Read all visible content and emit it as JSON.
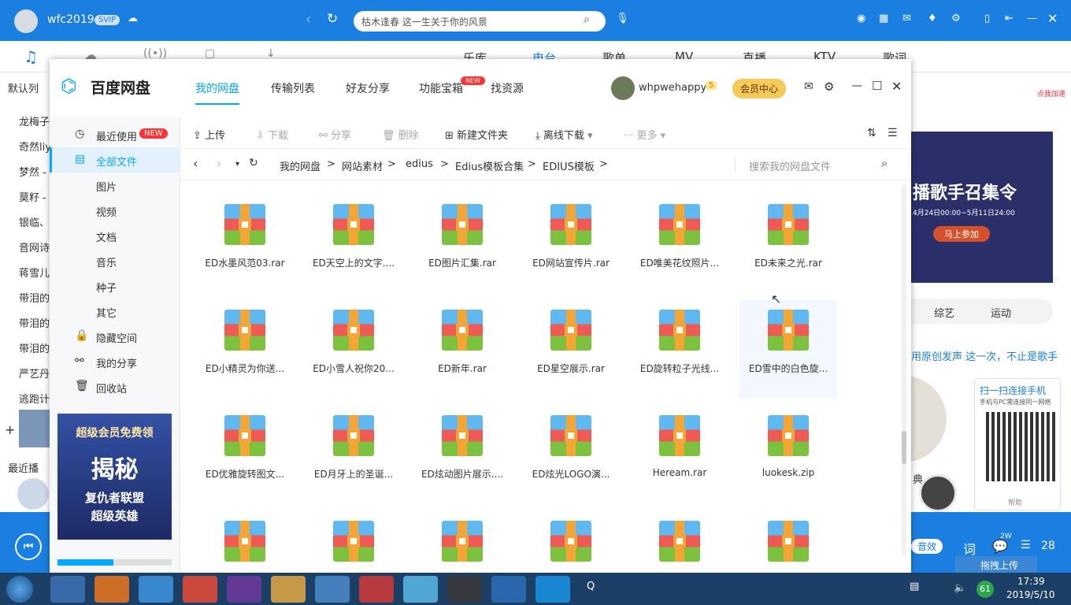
{
  "music_app": {
    "username": "wfc2019",
    "svip": "SVIP",
    "search_placeholder": "枯木逢春 这一生关于你的风景",
    "tabs": [
      "乐库",
      "电台",
      "歌单",
      "MV",
      "直播",
      "KTV",
      "歌词"
    ],
    "left_section": "默认列",
    "playlist": [
      "龙梅子",
      "奇然liy",
      "梦然 -",
      "莫籽 -",
      "银临、",
      "音网诗",
      "蒋雪儿",
      "带泪的",
      "带泪的",
      "带泪的",
      "严艺丹",
      "逃跑计"
    ],
    "recent_label": "最近播",
    "right_tabs": [
      "综艺",
      "运动"
    ],
    "right_caption": "用原创发声 这一次，不止是歌手",
    "promo_banner": "播歌手召集令",
    "promo_date": "4月24日00:00~5月11日24:00",
    "promo_button": "马上参加",
    "qr_title": "扫一扫连接手机",
    "qr_sub": "手机与PC需连接同一网络",
    "qr_help": "帮助",
    "bottom_sound": "音效",
    "bottom_lyric": "词",
    "bottom_comment_count": "2W",
    "bottom_list_count": "28",
    "upload_drag": "拖拽上传",
    "partial_dian": "典",
    "partial_label": "点我加速"
  },
  "pan": {
    "logo_text": "百度网盘",
    "nav": [
      "我的网盘",
      "传输列表",
      "好友分享",
      "功能宝箱",
      "找资源"
    ],
    "nav_new_badge": "NEW",
    "user": "whpwehappy",
    "vip_level": "5",
    "vip_center": "会员中心",
    "sidebar": {
      "recent": "最近使用",
      "recent_badge": "NEW",
      "all_files": "全部文件",
      "categories": [
        "图片",
        "视频",
        "文档",
        "音乐",
        "种子",
        "其它"
      ],
      "hidden_space": "隐藏空间",
      "my_share": "我的分享",
      "recycle": "回收站",
      "ad_line1": "超级会员免费领",
      "ad_line2": "揭秘",
      "ad_line3": "复仇者联盟",
      "ad_line4": "超级英雄"
    },
    "toolbar": {
      "upload": "上传",
      "download": "下载",
      "share": "分享",
      "delete": "删除",
      "new_folder": "新建文件夹",
      "offline": "离线下载",
      "more": "更多"
    },
    "path": [
      "我的网盘",
      "网站素材",
      "edius",
      "Edius模板合集",
      "EDIUS模板"
    ],
    "search_placeholder": "搜索我的网盘文件",
    "files": [
      "ED水墨风范03.rar",
      "ED天空上的文字....",
      "ED图片汇集.rar",
      "ED网站宣传片.rar",
      "ED唯美花纹照片...",
      "ED未来之光.rar",
      "ED小精灵为你送...",
      "ED小雪人祝你20...",
      "ED新年.rar",
      "ED星空展示.rar",
      "ED旋转粒子光线...",
      "ED雪中的白色旋...",
      "ED优雅旋转图文...",
      "ED月牙上的圣诞...",
      "ED炫动图片展示....",
      "ED炫光LOGO演...",
      "Heream.rar",
      "luokesk.zip",
      "",
      "",
      "",
      "",
      "",
      ""
    ]
  },
  "taskbar": {
    "time": "17:39",
    "date": "2019/5/10",
    "tray_number": "61"
  },
  "colors": {
    "music_blue": "#1a7fe0",
    "pan_blue": "#06a7ff",
    "zip_blue": "#5fb8ef",
    "zip_red": "#ef5a55",
    "zip_green": "#7dc23e",
    "zip_orange": "#f5a533"
  }
}
